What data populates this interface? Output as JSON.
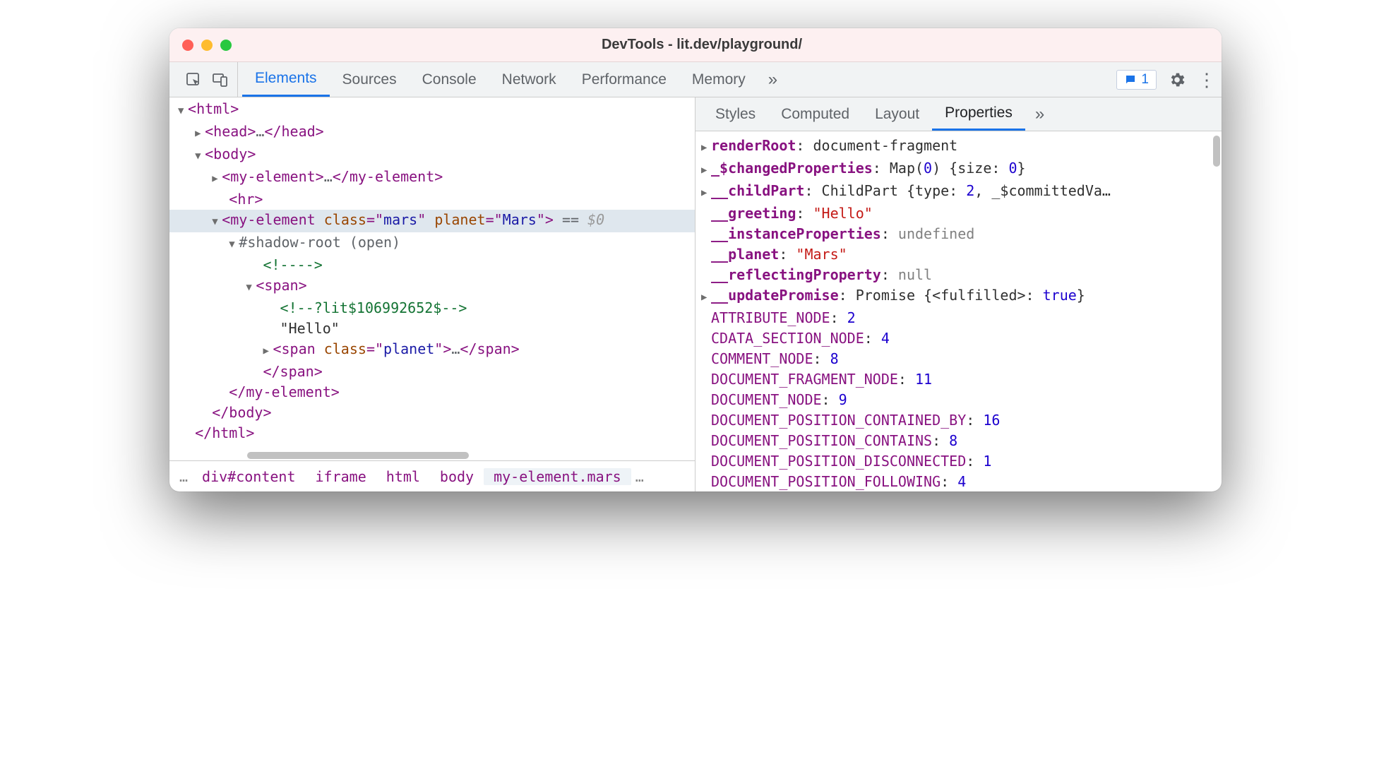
{
  "window": {
    "title": "DevTools - lit.dev/playground/"
  },
  "toolbar": {
    "tabs": [
      "Elements",
      "Sources",
      "Console",
      "Network",
      "Performance",
      "Memory"
    ],
    "active_tab": "Elements",
    "overflow": "»",
    "issues_count": "1"
  },
  "dom": {
    "l1": "<html>",
    "l2_open": "<head>",
    "l2_ell": "…",
    "l2_close": "</head>",
    "l3": "<body>",
    "l4_open": "<my-element>",
    "l4_ell": "…",
    "l4_close": "</my-element>",
    "l5": "<hr>",
    "l6_tag": "my-element",
    "l6_attr1n": "class",
    "l6_attr1v": "mars",
    "l6_attr2n": "planet",
    "l6_attr2v": "Mars",
    "l6_eq": " == ",
    "l6_ref": "$0",
    "l7": "#shadow-root (open)",
    "l8": "<!---->",
    "l9": "<span>",
    "l10": "<!--?lit$106992652$-->",
    "l11": "\"Hello\"",
    "l12_tag": "span",
    "l12_attrn": "class",
    "l12_attrv": "planet",
    "l12_ell": "…",
    "l12_close": "</span>",
    "l13": "</span>",
    "l14": "</my-element>",
    "l15": "</body>",
    "l16": "</html>"
  },
  "breadcrumb": {
    "ell_left": "…",
    "items": [
      "div#content",
      "iframe",
      "html",
      "body",
      "my-element.mars"
    ],
    "ell_right": "…"
  },
  "subtabs": {
    "items": [
      "Styles",
      "Computed",
      "Layout",
      "Properties"
    ],
    "active": "Properties",
    "overflow": "»"
  },
  "props": [
    {
      "tri": "▶",
      "key": "renderRoot",
      "bold": true,
      "colon": ": ",
      "val": "document-fragment",
      "vclass": "p-obj"
    },
    {
      "tri": "▶",
      "key": "_$changedProperties",
      "bold": true,
      "colon": ": ",
      "val": "Map(0) {size: 0}",
      "vclass": "p-obj",
      "numspan": "0"
    },
    {
      "tri": "▶",
      "key": "__childPart",
      "bold": true,
      "colon": ": ",
      "val": "ChildPart {type: 2, _$committedVa…",
      "vclass": "p-obj",
      "numspan": "2"
    },
    {
      "tri": "",
      "key": "__greeting",
      "bold": true,
      "colon": ": ",
      "val": "\"Hello\"",
      "vclass": "p-str"
    },
    {
      "tri": "",
      "key": "__instanceProperties",
      "bold": true,
      "colon": ": ",
      "val": "undefined",
      "vclass": "p-undef"
    },
    {
      "tri": "",
      "key": "__planet",
      "bold": true,
      "colon": ": ",
      "val": "\"Mars\"",
      "vclass": "p-str"
    },
    {
      "tri": "",
      "key": "__reflectingProperty",
      "bold": true,
      "colon": ": ",
      "val": "null",
      "vclass": "p-undef"
    },
    {
      "tri": "▶",
      "key": "__updatePromise",
      "bold": true,
      "colon": ": ",
      "val": "Promise {<fulfilled>: true}",
      "vclass": "p-obj",
      "boolspan": "true"
    },
    {
      "tri": "",
      "key": "ATTRIBUTE_NODE",
      "bold": false,
      "colon": ": ",
      "val": "2",
      "vclass": "p-num"
    },
    {
      "tri": "",
      "key": "CDATA_SECTION_NODE",
      "bold": false,
      "colon": ": ",
      "val": "4",
      "vclass": "p-num"
    },
    {
      "tri": "",
      "key": "COMMENT_NODE",
      "bold": false,
      "colon": ": ",
      "val": "8",
      "vclass": "p-num"
    },
    {
      "tri": "",
      "key": "DOCUMENT_FRAGMENT_NODE",
      "bold": false,
      "colon": ": ",
      "val": "11",
      "vclass": "p-num"
    },
    {
      "tri": "",
      "key": "DOCUMENT_NODE",
      "bold": false,
      "colon": ": ",
      "val": "9",
      "vclass": "p-num"
    },
    {
      "tri": "",
      "key": "DOCUMENT_POSITION_CONTAINED_BY",
      "bold": false,
      "colon": ": ",
      "val": "16",
      "vclass": "p-num"
    },
    {
      "tri": "",
      "key": "DOCUMENT_POSITION_CONTAINS",
      "bold": false,
      "colon": ": ",
      "val": "8",
      "vclass": "p-num"
    },
    {
      "tri": "",
      "key": "DOCUMENT_POSITION_DISCONNECTED",
      "bold": false,
      "colon": ": ",
      "val": "1",
      "vclass": "p-num"
    },
    {
      "tri": "",
      "key": "DOCUMENT_POSITION_FOLLOWING",
      "bold": false,
      "colon": ": ",
      "val": "4",
      "vclass": "p-num"
    }
  ]
}
